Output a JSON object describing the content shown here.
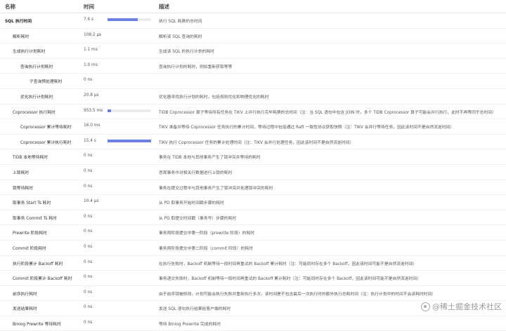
{
  "header": {
    "name": "名称",
    "time": "时间",
    "desc": "描述"
  },
  "rows": [
    {
      "name": "SQL 执行时间",
      "indent": 0,
      "bold": true,
      "time": "7.6 s",
      "bar": 0.7,
      "desc": "执行 SQL 耗费的总时间"
    },
    {
      "name": "解析耗时",
      "indent": 1,
      "time": "108.2 µs",
      "bar": 0,
      "desc": "解析该 SQL 查询的耗时"
    },
    {
      "name": "生成执行计划耗时",
      "indent": 1,
      "time": "1.1 ms",
      "bar": 0,
      "desc": "生成该 SQL 的执行计划的耗时"
    },
    {
      "name": "查询执行计划耗时",
      "indent": 2,
      "time": "1.0 ms",
      "bar": 0,
      "desc": "查询执行计划的耗时，例如重新获取等等"
    },
    {
      "name": "子查询预处理耗时",
      "indent": 3,
      "time": "0 ns",
      "bar": 0,
      "desc": ""
    },
    {
      "name": "优化执行计划耗时",
      "indent": 2,
      "time": "20.8 µs",
      "bar": 0,
      "desc": "优化器寻找执行计划的耗时，包括规则优化和物理优化的耗时"
    },
    {
      "name": "Coprocessor 执行耗时",
      "indent": 1,
      "time": "953.5 ms",
      "bar": 0.08,
      "desc": "TiDB Coprocessor 算子等待所有任务在 TiKV 上并行执行完毕耗费的总时间（注：当 SQL 语句中包含 JOIN 时，多个 TiDB Coprocessor 算子可能会并行执行，此时不再等同于总时间）"
    },
    {
      "name": "Coprocessor 累计等待耗时",
      "indent": 2,
      "time": "16.0 ms",
      "bar": 0,
      "desc": "TiKV 准备并等待 Coprocessor 任务执行的累计时间，等待过程中包括通过 Raft 一致性协议获取快照（注：TiKV 会并行等待任务，因此该时间不是自然流逝时间）"
    },
    {
      "name": "Coprocessor 累计执行耗时",
      "indent": 2,
      "time": "15.4 s",
      "bar": 1.0,
      "desc": "TiKV 执行 Coprocessor 任务的累计处理时间（注：TiKV 会并行处理任务，因此该时间不是自然流逝时间）"
    },
    {
      "name": "TiDB 本地等待耗时",
      "indent": 1,
      "time": "0 ns",
      "bar": 0,
      "desc": "事务在 TiDB 本地与其他事务产生了锁冲突并等待的耗时"
    },
    {
      "name": "上锁耗时",
      "indent": 1,
      "time": "0 ns",
      "bar": 0,
      "desc": "悲观事务中对相关行数据进行上锁的耗时"
    },
    {
      "name": "锁等待耗时",
      "indent": 1,
      "time": "0 ns",
      "bar": 0,
      "desc": "事务在提交过程中与其他事务产生了锁冲突并处理锁冲突的耗时"
    },
    {
      "name": "取事务 Start Ts 耗时",
      "indent": 1,
      "time": "10.4 µs",
      "bar": 0,
      "desc": "从 PD 取事务开始时间戳步骤的耗时"
    },
    {
      "name": "取事务 Commit Ts 耗时",
      "indent": 1,
      "time": "0 ns",
      "bar": 0,
      "desc": "从 PD 取提交时间戳（事务号）步骤的耗时"
    },
    {
      "name": "Prewrite 阶段耗时",
      "indent": 1,
      "time": "0 ns",
      "bar": 0,
      "desc": "事务两阶段提交中第一阶段（prewrite 阶段）的耗时"
    },
    {
      "name": "Commit 阶段耗时",
      "indent": 1,
      "time": "0 ns",
      "bar": 0,
      "desc": "事务两阶段提交中第二阶段（commit 阶段）的耗时"
    },
    {
      "name": "执行阶段累计 Backoff 耗时",
      "indent": 1,
      "time": "0 ns",
      "bar": 0,
      "desc": "在执行失败时，Backoff 机制等待一段时间再重试的 Backoff 累计耗时（注：可能同时存在多个 Backoff，因此该时间可能不是自然流逝时间）"
    },
    {
      "name": "Commit 阶段累计 Backoff 耗时",
      "indent": 1,
      "time": "0 ns",
      "bar": 0,
      "desc": "事务递交失败时，Backoff 机制等待一段时间再重试的 Backoff 累计耗时（注：可能同时存在多个 Backoff，因此该时间可能不是自然流逝时间）"
    },
    {
      "name": "前序执行耗时",
      "indent": 1,
      "time": "0 ns",
      "bar": 0,
      "desc": "由于前序锁被修改，计划可能会执行失败并重新执行多次，该时间是不包含最后一次执行时的额外执行总耗时间（注：执行计划中的时间不会该耗时时间）"
    },
    {
      "name": "发送结果耗时",
      "indent": 1,
      "time": "0 ns",
      "bar": 0,
      "desc": "发送 SQL 语句执行结果给客户端的耗时"
    },
    {
      "name": "Binlog Prewrite 等待耗时",
      "indent": 1,
      "time": "0 ns",
      "bar": 0,
      "desc": "等待 Binlog Prewrite 完成的耗时"
    }
  ],
  "watermark": {
    "text": "@稀土掘金技术社区"
  },
  "colors": {
    "bar": "#6b80e0",
    "track": "#ebebeb"
  }
}
